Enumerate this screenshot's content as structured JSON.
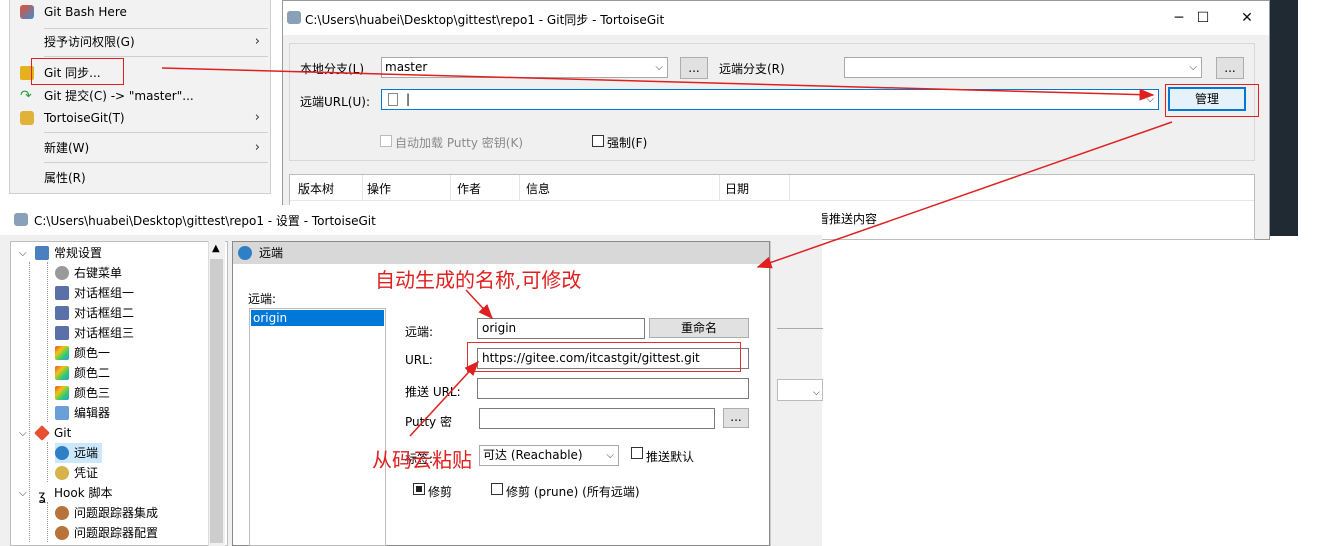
{
  "context_menu": {
    "items": [
      {
        "label": "Git Bash Here",
        "icon": "git-bash-icon"
      },
      {
        "label": "授予访问权限(G)",
        "submenu": true
      },
      {
        "label": "Git 同步...",
        "icon": "git-sync-icon",
        "highlighted": true
      },
      {
        "label": "Git 提交(C) -> \"master\"...",
        "icon": "git-commit-icon"
      },
      {
        "label": "TortoiseGit(T)",
        "icon": "tortoisegit-icon",
        "submenu": true
      },
      {
        "label": "新建(W)",
        "submenu": true
      },
      {
        "label": "属性(R)"
      }
    ]
  },
  "sync_dialog": {
    "title": "C:\\Users\\huabei\\Desktop\\gittest\\repo1 - Git同步 - TortoiseGit",
    "local_branch_label": "本地分支(L)",
    "local_branch_value": "master",
    "remote_branch_label": "远端分支(R)",
    "remote_url_label": "远端URL(U):",
    "browse_label": "...",
    "manage_label": "管理",
    "putty_label": "自动加载 Putty 密钥(K)",
    "force_label": "强制(F)",
    "columns": [
      "版本树",
      "操作",
      "作者",
      "信息",
      "日期"
    ],
    "partial_text": "看推送内容"
  },
  "settings_dialog": {
    "title": "C:\\Users\\huabei\\Desktop\\gittest\\repo1 - 设置 - TortoiseGit",
    "tree": [
      {
        "label": "常规设置",
        "icon": "wrench-icon",
        "level": 0,
        "expanded": true
      },
      {
        "label": "右键菜单",
        "icon": "gear-icon",
        "level": 1
      },
      {
        "label": "对话框组一",
        "icon": "dialog-icon",
        "level": 1
      },
      {
        "label": "对话框组二",
        "icon": "dialog-icon",
        "level": 1
      },
      {
        "label": "对话框组三",
        "icon": "dialog-icon",
        "level": 1
      },
      {
        "label": "颜色一",
        "icon": "color-icon",
        "level": 1
      },
      {
        "label": "颜色二",
        "icon": "color-icon",
        "level": 1
      },
      {
        "label": "颜色三",
        "icon": "color-icon",
        "level": 1
      },
      {
        "label": "编辑器",
        "icon": "editor-icon",
        "level": 1
      },
      {
        "label": "Git",
        "icon": "git-icon",
        "level": 0,
        "expanded": true
      },
      {
        "label": "远端",
        "icon": "globe-icon",
        "level": 1,
        "selected": true
      },
      {
        "label": "凭证",
        "icon": "credential-icon",
        "level": 1
      },
      {
        "label": "Hook 脚本",
        "icon": "hook-icon",
        "level": 0,
        "expanded": true
      },
      {
        "label": "问题跟踪器集成",
        "icon": "bug-icon",
        "level": 1
      },
      {
        "label": "问题跟踪器配置",
        "icon": "bug-icon",
        "level": 1
      }
    ],
    "panel": {
      "header": "远端",
      "remotes_label": "远端:",
      "remotes": [
        "origin"
      ],
      "remote_name_label": "远端:",
      "remote_name_value": "origin",
      "rename_label": "重命名",
      "url_label": "URL:",
      "url_value": "https://gitee.com/itcastgit/gittest.git",
      "push_url_label": "推送 URL:",
      "putty_label": "Putty 密",
      "browse_label": "...",
      "tag_label": "标签:",
      "tag_value": "可达 (Reachable)",
      "push_default_label": "推送默认",
      "prune_label": "修剪",
      "prune_all_label": "修剪 (prune) (所有远端)"
    }
  },
  "annotations": {
    "auto_name": "自动生成的名称,可修改",
    "paste_from_gitee": "从码云粘贴"
  },
  "colors": {
    "annotation_red": "#e02020",
    "selection_blue": "#0078d7",
    "dialog_bg": "#f0f0f0"
  }
}
